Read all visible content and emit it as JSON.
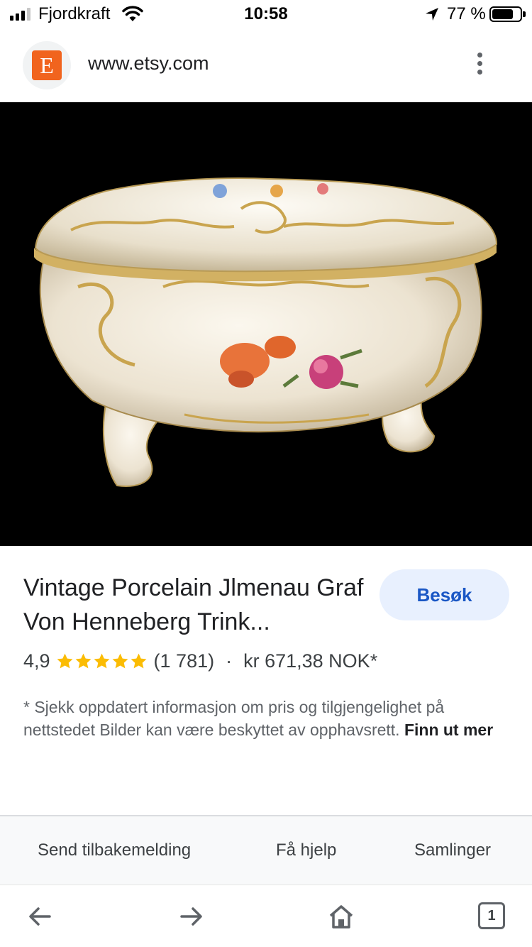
{
  "status_bar": {
    "carrier": "Fjordkraft",
    "time": "10:58",
    "battery_percent": "77 %",
    "battery_level": 0.77,
    "signal_bars_filled": 3,
    "signal_bars_total": 4
  },
  "address_bar": {
    "favicon_letter": "E",
    "url": "www.etsy.com",
    "menu_icon": "more-vert-icon"
  },
  "product": {
    "title": "Vintage Porcelain Jlmenau Graf Von Henneberg Trink...",
    "visit_label": "Besøk",
    "rating": "4,9",
    "stars": 5,
    "reviews": "(1 781)",
    "separator": "·",
    "price": "kr 671,38 NOK*",
    "disclaimer": "* Sjekk oppdatert informasjon om pris og tilgjengelighet på nettstedet Bilder kan være beskyttet av opphavsrett.",
    "learn_more": "Finn ut mer"
  },
  "feedback": {
    "send_feedback": "Send tilbakemelding",
    "get_help": "Få hjelp",
    "collections": "Samlinger"
  },
  "toolbar": {
    "tab_count": "1",
    "icons": [
      "back-arrow-icon",
      "forward-arrow-icon",
      "home-icon",
      "tabs-icon"
    ]
  },
  "colors": {
    "star": "#fbbc04",
    "visit_bg": "#e8f0fe",
    "visit_text": "#1a57c5",
    "etsy": "#f1641e"
  }
}
